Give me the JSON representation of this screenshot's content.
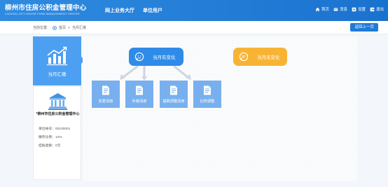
{
  "header": {
    "logo_cn": "柳州市住房公积金管理中心",
    "logo_en": "LIUZHOU CITY HOUSE FUND MANAGEMENT CENTER",
    "nav": [
      "网上业务大厅",
      "单位用户"
    ],
    "links": [
      {
        "label": "首页",
        "icon": "home-icon"
      },
      {
        "label": "消息",
        "icon": "message-icon"
      },
      {
        "label": "设置",
        "icon": "settings-icon"
      },
      {
        "label": "退出",
        "icon": "logout-icon"
      }
    ]
  },
  "breadcrumb": {
    "prefix": "当前位置：",
    "home": "首页",
    "separator": ">",
    "current": "当月汇缴"
  },
  "back_button": "返回上一页",
  "left_panel": {
    "active_label": "当月汇缴",
    "org_name": "*柳州市住房公积金管理中心",
    "info": [
      {
        "label": "单位帐号：",
        "value": "00100001"
      },
      {
        "label": "缴存比例：",
        "value": "12%"
      },
      {
        "label": "挂账金额：",
        "value": "0元"
      }
    ]
  },
  "main": {
    "changed_label": "当月有变化",
    "unchanged_label": "当月无变化",
    "tiles": [
      "变更清册",
      "补缴清册",
      "基数调整清册",
      "比例调整"
    ]
  },
  "colors": {
    "header_blue": "#1a72cf",
    "accent_blue": "#2f8be8",
    "tile_blue": "#78b0ef",
    "orange": "#f7b434"
  }
}
